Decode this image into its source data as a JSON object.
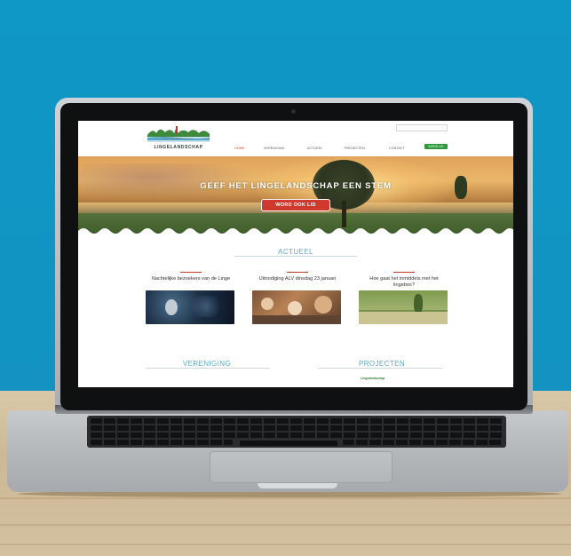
{
  "site": {
    "logo": {
      "tagline": "Natuurlijk Buitengewoon",
      "name": "LINGELANDSCHAP"
    },
    "nav": {
      "items": [
        "HOME",
        "VERENIGING",
        "ACTUEEL",
        "PROJECTEN",
        "CONTACT"
      ],
      "active_index": 0,
      "cta": "WORD LID"
    },
    "hero": {
      "title": "GEEF HET LINGELANDSCHAP EEN STEM",
      "cta": "WORD OOK LID"
    },
    "news": {
      "title": "ACTUEEL",
      "items": [
        {
          "date": "",
          "title": "Nachtelijke bezoekers van de Linge"
        },
        {
          "date": "",
          "title": "Uitnodiging ALV dinsdag 23 januari"
        },
        {
          "date": "",
          "title": "Hoe gaat het inmiddels met het lingebos?"
        }
      ]
    },
    "bottom": {
      "left_title": "VERENIGING",
      "left_text": "",
      "right_title": "PROJECTEN",
      "right_link": "Lingelandschap"
    }
  },
  "colors": {
    "wall": "#1195c4",
    "accent_red": "#c0392b",
    "accent_green": "#2f9a3c",
    "section_blue": "#5fa9c4"
  }
}
